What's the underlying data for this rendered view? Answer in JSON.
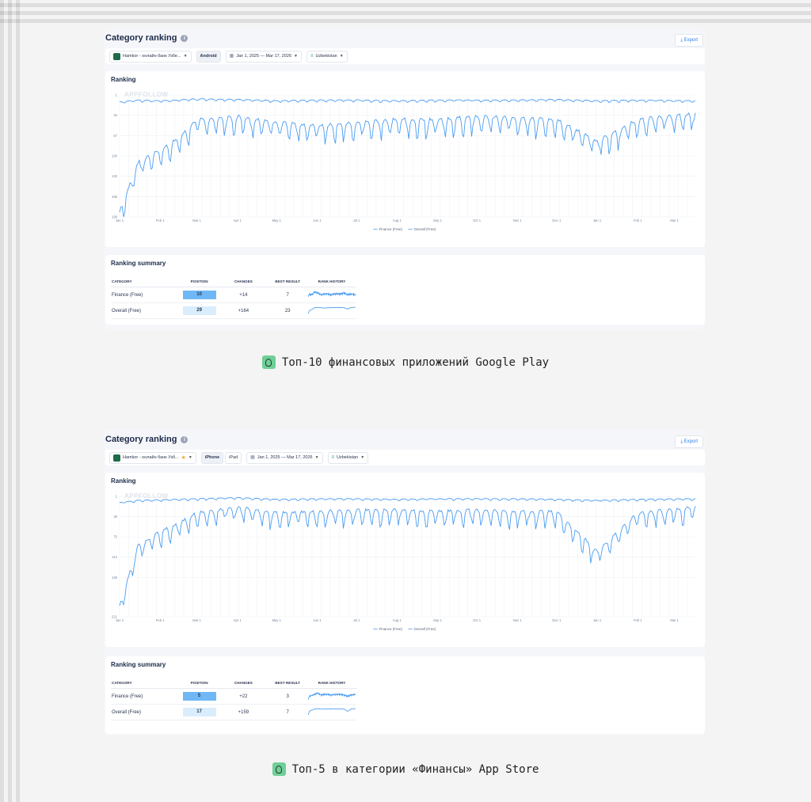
{
  "panels": [
    {
      "title": "Category ranking",
      "export_label": "Export",
      "app_name": "Hamkor - онлайн банк Узбе...",
      "devices": [
        "Android"
      ],
      "date_range": "Jan 1, 2025 — Mar 17, 2026",
      "country": "Uzbekistan",
      "chart_title": "Ranking",
      "watermark": "APPFOLLOW",
      "legend": [
        "Finance (Free)",
        "Overall (Free)"
      ],
      "summary_title": "Ranking summary",
      "summary_headers": [
        "CATEGORY",
        "POSITION",
        "CHANGES",
        "BEST RESULT",
        "RANK HISTORY"
      ],
      "summary_rows": [
        {
          "category": "Finance (Free)",
          "position": "10",
          "changes": "+14",
          "best": "7"
        },
        {
          "category": "Overall (Free)",
          "position": "29",
          "changes": "+164",
          "best": "23"
        }
      ],
      "caption": "Топ-10 финансовых приложений Google Play"
    },
    {
      "title": "Category ranking",
      "export_label": "Export",
      "app_name": "Hamkor - онлайн банк Узб...",
      "devices": [
        "iPhone",
        "iPad"
      ],
      "date_range": "Jan 1, 2025 — Mar 17, 2026",
      "country": "Uzbekistan",
      "chart_title": "Ranking",
      "watermark": "APPFOLLOW",
      "legend": [
        "Finance (Free)",
        "Overall (Free)"
      ],
      "summary_title": "Ranking summary",
      "summary_headers": [
        "CATEGORY",
        "POSITION",
        "CHANGES",
        "BEST RESULT",
        "RANK HISTORY"
      ],
      "summary_rows": [
        {
          "category": "Finance (Free)",
          "position": "5",
          "changes": "+22",
          "best": "3"
        },
        {
          "category": "Overall (Free)",
          "position": "17",
          "changes": "+159",
          "best": "7"
        }
      ],
      "caption": "Топ-5 в категории «Финансы» App Store"
    }
  ],
  "colors": {
    "line": "#4a9cf0",
    "pos_strong": "#6fb8f5",
    "pos_light": "#d9edfc",
    "changes": "#2ecc71"
  },
  "chart_data": [
    {
      "type": "line",
      "title": "Ranking",
      "x_ticks": [
        "Jan 1",
        "Feb 1",
        "Mar 1",
        "Apr 1",
        "May 1",
        "Jun 1",
        "Jul 1",
        "Aug 1",
        "Sep 1",
        "Oct 1",
        "Nov 1",
        "Dec 1",
        "Jan 1",
        "Feb 1",
        "Mar 1"
      ],
      "y_ticks": [
        1,
        34,
        67,
        100,
        133,
        166,
        199
      ],
      "ylim": [
        1,
        199
      ],
      "y_inverted": true,
      "series": [
        {
          "name": "Finance (Free)",
          "x": [
            "2025-01-01",
            "2025-01-15",
            "2025-02-01",
            "2025-02-15",
            "2025-03-01",
            "2025-04-01",
            "2025-05-01",
            "2025-06-01",
            "2025-07-01",
            "2025-08-01",
            "2025-09-01",
            "2025-10-01",
            "2025-11-01",
            "2025-12-01",
            "2026-01-01",
            "2026-02-01",
            "2026-03-17"
          ],
          "y": [
            12,
            9,
            10,
            9,
            7,
            8,
            10,
            9,
            9,
            10,
            9,
            9,
            9,
            8,
            10,
            9,
            10
          ]
        },
        {
          "name": "Overall (Free)",
          "x": [
            "2025-01-01",
            "2025-01-15",
            "2025-02-01",
            "2025-02-15",
            "2025-03-01",
            "2025-04-01",
            "2025-05-01",
            "2025-06-01",
            "2025-07-01",
            "2025-08-01",
            "2025-09-01",
            "2025-10-01",
            "2025-11-01",
            "2025-12-01",
            "2026-01-01",
            "2026-02-01",
            "2026-03-17"
          ],
          "y": [
            190,
            110,
            90,
            70,
            40,
            35,
            45,
            50,
            45,
            40,
            40,
            35,
            38,
            40,
            75,
            40,
            30
          ]
        }
      ]
    },
    {
      "type": "line",
      "title": "Ranking",
      "x_ticks": [
        "Jan 1",
        "Feb 1",
        "Mar 1",
        "Apr 1",
        "May 1",
        "Jun 1",
        "Jul 1",
        "Aug 1",
        "Sep 1",
        "Oct 1",
        "Nov 1",
        "Dec 1",
        "Jan 1",
        "Feb 1",
        "Mar 1"
      ],
      "y_ticks": [
        1,
        38,
        75,
        112,
        149,
        221
      ],
      "ylim": [
        1,
        221
      ],
      "y_inverted": true,
      "series": [
        {
          "name": "Finance (Free)",
          "x": [
            "2025-01-01",
            "2025-01-15",
            "2025-02-01",
            "2025-02-15",
            "2025-03-01",
            "2025-04-01",
            "2025-05-01",
            "2025-06-01",
            "2025-07-01",
            "2025-08-01",
            "2025-09-01",
            "2025-10-01",
            "2025-11-01",
            "2025-12-01",
            "2026-01-01",
            "2026-02-01",
            "2026-03-17"
          ],
          "y": [
            12,
            8,
            7,
            6,
            5,
            3,
            6,
            5,
            5,
            6,
            5,
            5,
            5,
            6,
            8,
            6,
            5
          ]
        },
        {
          "name": "Overall (Free)",
          "x": [
            "2025-01-01",
            "2025-01-15",
            "2025-02-01",
            "2025-02-15",
            "2025-03-01",
            "2025-04-01",
            "2025-05-01",
            "2025-06-01",
            "2025-07-01",
            "2025-08-01",
            "2025-09-01",
            "2025-10-01",
            "2025-11-01",
            "2025-12-01",
            "2026-01-01",
            "2026-02-01",
            "2026-03-17"
          ],
          "y": [
            200,
            90,
            65,
            50,
            30,
            20,
            30,
            28,
            25,
            25,
            28,
            25,
            28,
            28,
            100,
            30,
            20
          ]
        }
      ]
    }
  ]
}
